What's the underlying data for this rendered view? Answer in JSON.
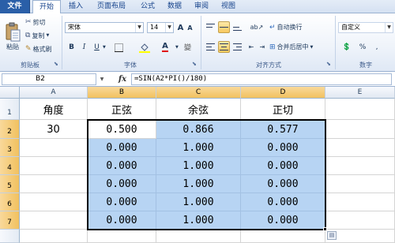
{
  "tabs": [
    "文件",
    "开始",
    "插入",
    "页面布局",
    "公式",
    "数据",
    "审阅",
    "视图"
  ],
  "clipboard": {
    "paste_label": "粘贴",
    "cut_label": "剪切",
    "copy_label": "复制",
    "format_painter_label": "格式刷",
    "group_label": "剪贴板"
  },
  "font": {
    "font_name": "宋体",
    "font_size": "14",
    "bold": "B",
    "italic": "I",
    "underline": "U",
    "group_label": "字体",
    "grow": "A",
    "shrink": "A"
  },
  "alignment": {
    "wrap_label": "自动换行",
    "merge_label": "合并后居中",
    "group_label": "对齐方式"
  },
  "number": {
    "format": "自定义",
    "group_label": "数字"
  },
  "formula_bar": {
    "name_box": "B2",
    "fx": "fx",
    "formula": "=SIN(A2*PI()/180)"
  },
  "columns": [
    "A",
    "B",
    "C",
    "D",
    "E"
  ],
  "rows": [
    "1",
    "2",
    "3",
    "4",
    "5",
    "6",
    "7"
  ],
  "cells": {
    "A1": "角度",
    "B1": "正弦",
    "C1": "余弦",
    "D1": "正切",
    "A2": "30",
    "B2": "0.500",
    "C2": "0.866",
    "D2": "0.577",
    "B3": "0.000",
    "C3": "1.000",
    "D3": "0.000",
    "B4": "0.000",
    "C4": "1.000",
    "D4": "0.000",
    "B5": "0.000",
    "C5": "1.000",
    "D5": "0.000",
    "B6": "0.000",
    "C6": "1.000",
    "D6": "0.000",
    "B7": "0.000",
    "C7": "1.000",
    "D7": "0.000"
  },
  "colors": {
    "selection_fill": "#b7d4f3",
    "header_selected": "#f1c15f",
    "file_tab": "#2a5fa8"
  }
}
